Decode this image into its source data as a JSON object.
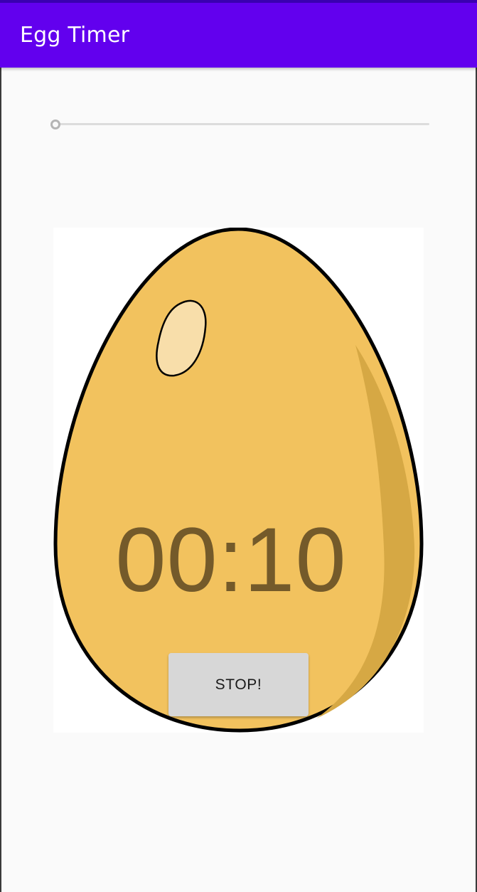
{
  "app_bar": {
    "title": "Egg Timer",
    "color": "#6200ee"
  },
  "seekbar": {
    "progress": 0
  },
  "egg": {
    "fill_color": "#f2c25e",
    "shade_color": "#d6a844",
    "highlight_color": "#f8deaa",
    "outline_color": "#000000"
  },
  "timer": {
    "text": "00:10",
    "color": "#745a2a"
  },
  "stop_button": {
    "label": "STOP!"
  }
}
